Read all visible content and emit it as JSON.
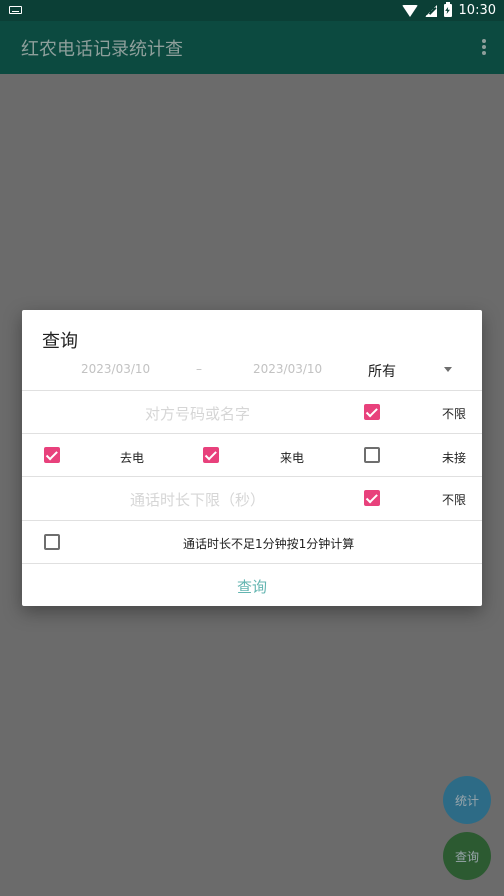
{
  "status_bar": {
    "time": "10:30",
    "icons": [
      "keyboard-icon",
      "wifi-icon",
      "signal-icon",
      "battery-icon"
    ]
  },
  "app_bar": {
    "title": "红农电话记录统计查",
    "menu_icon": "more-vert-icon"
  },
  "dialog": {
    "title": "查询",
    "date_from": "2023/03/10",
    "date_separator": "–",
    "date_to": "2023/03/10",
    "call_type_selected": "所有",
    "number_hint": "对方号码或名字",
    "number_unlimited": {
      "label": "不限",
      "checked": true
    },
    "outgoing": {
      "label": "去电",
      "checked": true
    },
    "incoming": {
      "label": "来电",
      "checked": true
    },
    "missed": {
      "label": "未接",
      "checked": false
    },
    "duration_hint": "通话时长下限（秒）",
    "duration_unlimited": {
      "label": "不限",
      "checked": true
    },
    "round_minute": {
      "label": "通话时长不足1分钟按1分钟计算",
      "checked": false
    },
    "confirm_label": "查询"
  },
  "fabs": {
    "stat_label": "统计",
    "query_label": "查询"
  },
  "colors": {
    "accent": "#e8417c",
    "primary_dark": "#0b3f36",
    "dialog_button": "#64b5b1"
  }
}
